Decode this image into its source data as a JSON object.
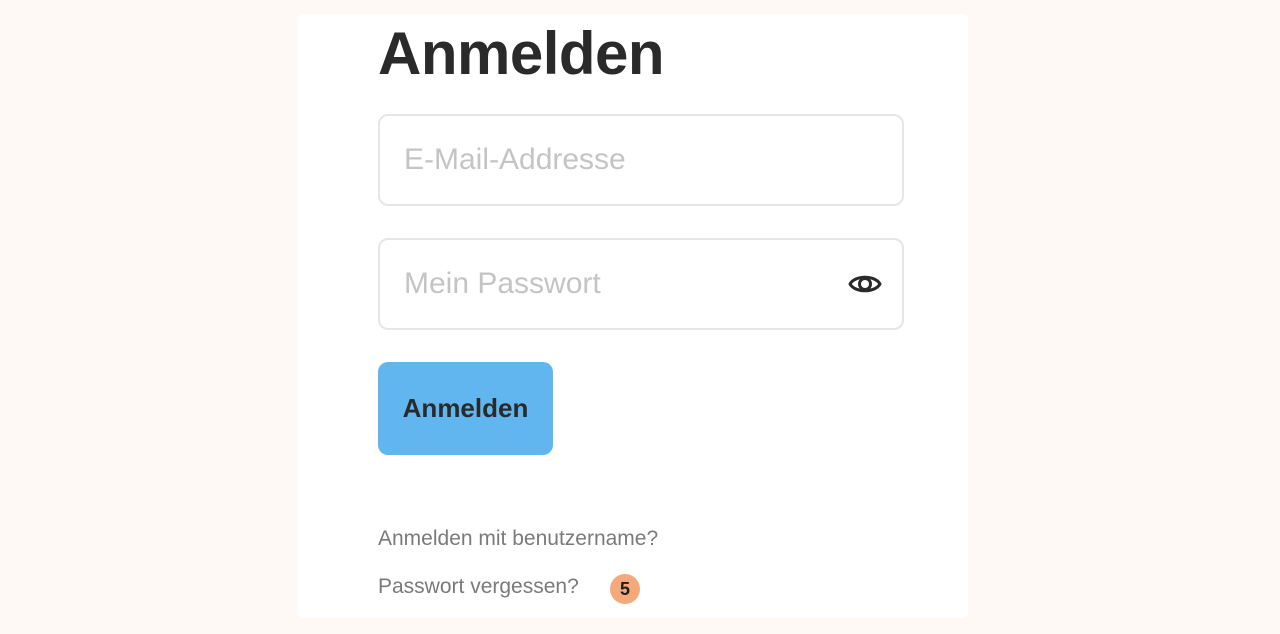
{
  "login": {
    "title": "Anmelden",
    "email": {
      "placeholder": "E-Mail-Addresse",
      "value": ""
    },
    "password": {
      "placeholder": "Mein Passwort",
      "value": "",
      "toggle_icon": "eye-icon"
    },
    "submit_label": "Anmelden",
    "username_login_link": "Anmelden mit benutzername?",
    "forgot_password_link": "Passwort vergessen?",
    "badge_count": "5"
  },
  "colors": {
    "page_background": "#fef9f5",
    "card_background": "#ffffff",
    "button_background": "#62b6f0",
    "badge_background": "#f4a97a",
    "title_text": "#2a2a2a",
    "placeholder_text": "#c4c4c4",
    "link_text": "#7a7a7a"
  }
}
